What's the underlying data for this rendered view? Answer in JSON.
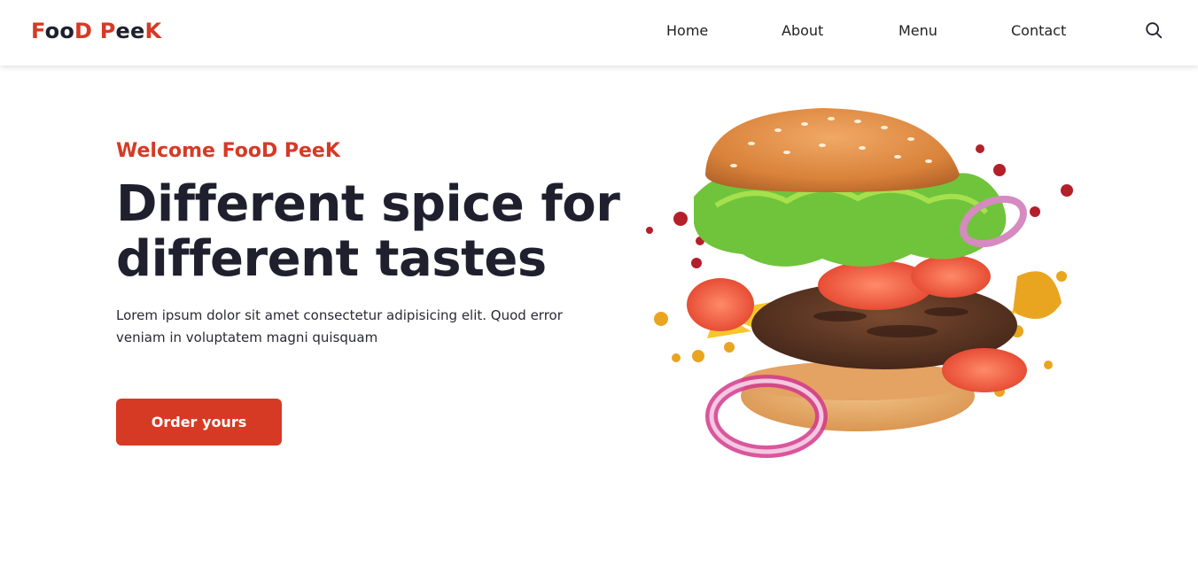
{
  "nav": {
    "logo_parts": [
      "F",
      "oo",
      "D",
      " ",
      "P",
      "ee",
      "K"
    ],
    "links": [
      "Home",
      "About",
      "Menu",
      "Contact"
    ],
    "search_icon": "search-icon"
  },
  "hero": {
    "welcome": "Welcome FooD PeeK",
    "headline_line1": "Different spice for",
    "headline_line2": "different tastes",
    "description": "Lorem ipsum dolor sit amet consectetur adipisicing elit. Quod error veniam in voluptatem magni quisquam",
    "cta_label": "Order yours"
  },
  "colors": {
    "accent": "#d63a25",
    "text_dark": "#1f1f2e"
  }
}
